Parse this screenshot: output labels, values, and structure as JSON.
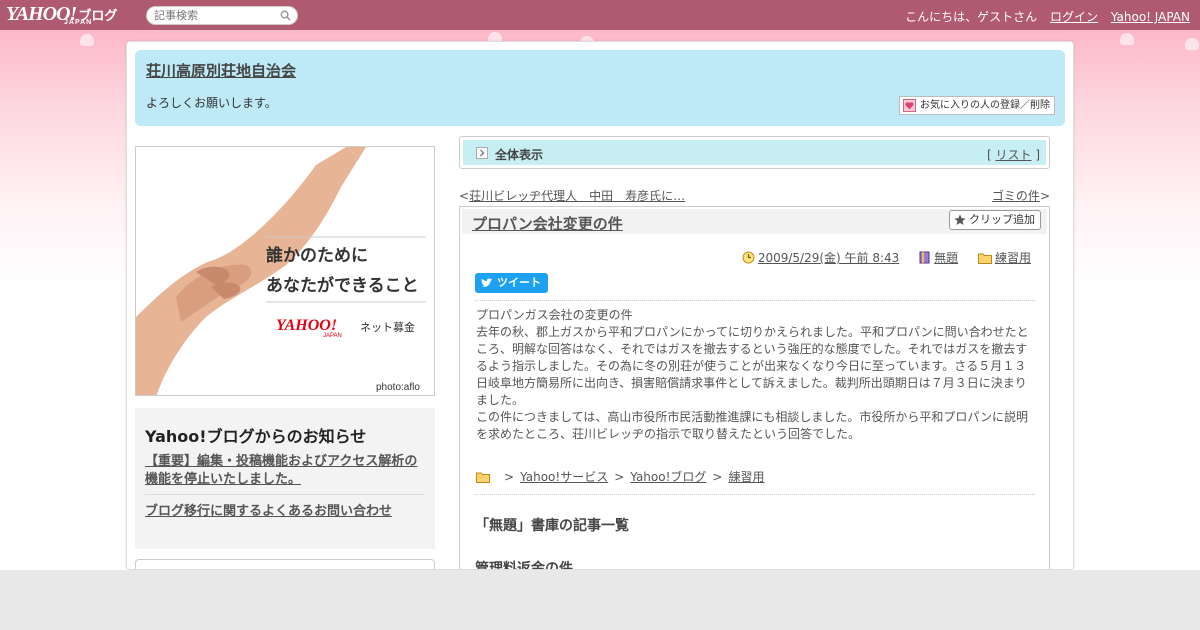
{
  "topbar": {
    "logo_text": "YAHOO!",
    "logo_sub": "JAPAN",
    "logo_blog": "ブログ",
    "search_placeholder": "記事検索",
    "greeting": "こんにちは、ゲストさん",
    "login": "ログイン",
    "yahoo_japan": "Yahoo! JAPAN"
  },
  "header": {
    "title": "荘川高原別荘地自治会",
    "description": "よろしくお願いします。",
    "fav_button": "お気に入りの人の登録／削除"
  },
  "banner": {
    "line1": "誰かのために",
    "line2": "あなたができること",
    "brand": "YAHOO!",
    "brand_sub": "JAPAN",
    "brand_suffix": "ネット募金",
    "credit": "photo:aflo"
  },
  "notice": {
    "title": "Yahoo!ブログからのお知らせ",
    "item1": "【重要】編集・投稿機能およびアクセス解析の機能を停止いたしました。",
    "item2": "ブログ移行に関するよくあるお問い合わせ"
  },
  "viewbar": {
    "all": "全体表示",
    "list_open": "[ ",
    "list": "リスト",
    "list_close": " ]"
  },
  "nav": {
    "prev_mark": "<",
    "prev": "荘川ビレッヂ代理人　中田　寿彦氏に…",
    "next": "ゴミの件",
    "next_mark": ">"
  },
  "article": {
    "title": "プロパン会社変更の件",
    "clip": "クリップ追加",
    "date": "2009/5/29(金) 午前 8:43",
    "category": "無題",
    "folder": "練習用",
    "tweet": "ツイート",
    "body": [
      "プロパンガス会社の変更の件",
      "去年の秋、郡上ガスから平和プロパンにかってに切りかえられました。平和プロパンに問い合わせたところ、明解な回答はなく、それではガスを撤去するという強圧的な態度でした。それではガスを撤去するよう指示しました。その為に冬の別荘が使うことが出来なくなり今日に至っています。さる５月１３日岐阜地方簡易所に出向き、損害賠償請求事件として訴えました。裁判所出頭期日は７月３日に決まりました。",
      "この件につきましては、高山市役所市民活動推進課にも相談しました。市役所から平和プロパンに説明を求めたところ、荘川ビレッヂの指示で取り替えたという回答でした。"
    ],
    "crumbs": [
      "Yahoo!サービス",
      "Yahoo!ブログ",
      "練習用"
    ],
    "crumb_sep": ">",
    "library_heading": "「無題」書庫の記事一覧",
    "library_item": "管理料返金の件"
  },
  "colors": {
    "topbar": "#b05a6f",
    "header_bg": "#bee9f6",
    "viewbar_bg": "#c7eef2",
    "tweet": "#1da1f2"
  }
}
